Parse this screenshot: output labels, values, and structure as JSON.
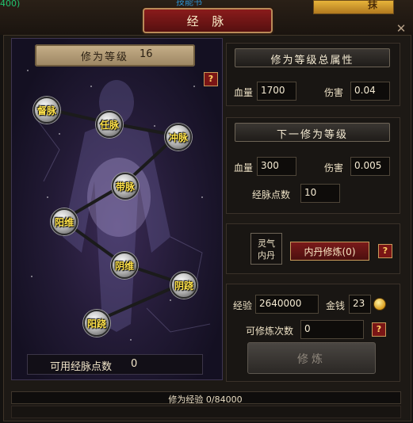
{
  "top": {
    "corner_text": "400)",
    "tab_text": "技能书",
    "gold_tile_text": "抹"
  },
  "window": {
    "title": "经 脉"
  },
  "left": {
    "level_label": "修为等级",
    "level_value": "16",
    "nodes": [
      "督脉",
      "任脉",
      "冲脉",
      "带脉",
      "阳维",
      "阴维",
      "阴跷",
      "阳跷"
    ],
    "points_label": "可用经脉点数",
    "points_value": "0"
  },
  "totals": {
    "header": "修为等级总属性",
    "hp_label": "血量",
    "hp_value": "1700",
    "dmg_label": "伤害",
    "dmg_value": "0.04"
  },
  "next": {
    "header": "下一修为等级",
    "hp_label": "血量",
    "hp_value": "300",
    "dmg_label": "伤害",
    "dmg_value": "0.005",
    "points_label": "经脉点数",
    "points_value": "10"
  },
  "neidan": {
    "lingqi_line1": "灵气",
    "lingqi_line2": "内丹",
    "button_label": "内丹修炼(0)"
  },
  "resources": {
    "exp_label": "经验",
    "exp_value": "2640000",
    "gold_label": "金钱",
    "gold_value": "23",
    "refine_count_label": "可修炼次数",
    "refine_count_value": "0",
    "refine_button": "修炼"
  },
  "footer": {
    "exp_progress_text": "修为经验 0/84000",
    "exp_progress_fraction": 0
  },
  "help_icon": "?"
}
